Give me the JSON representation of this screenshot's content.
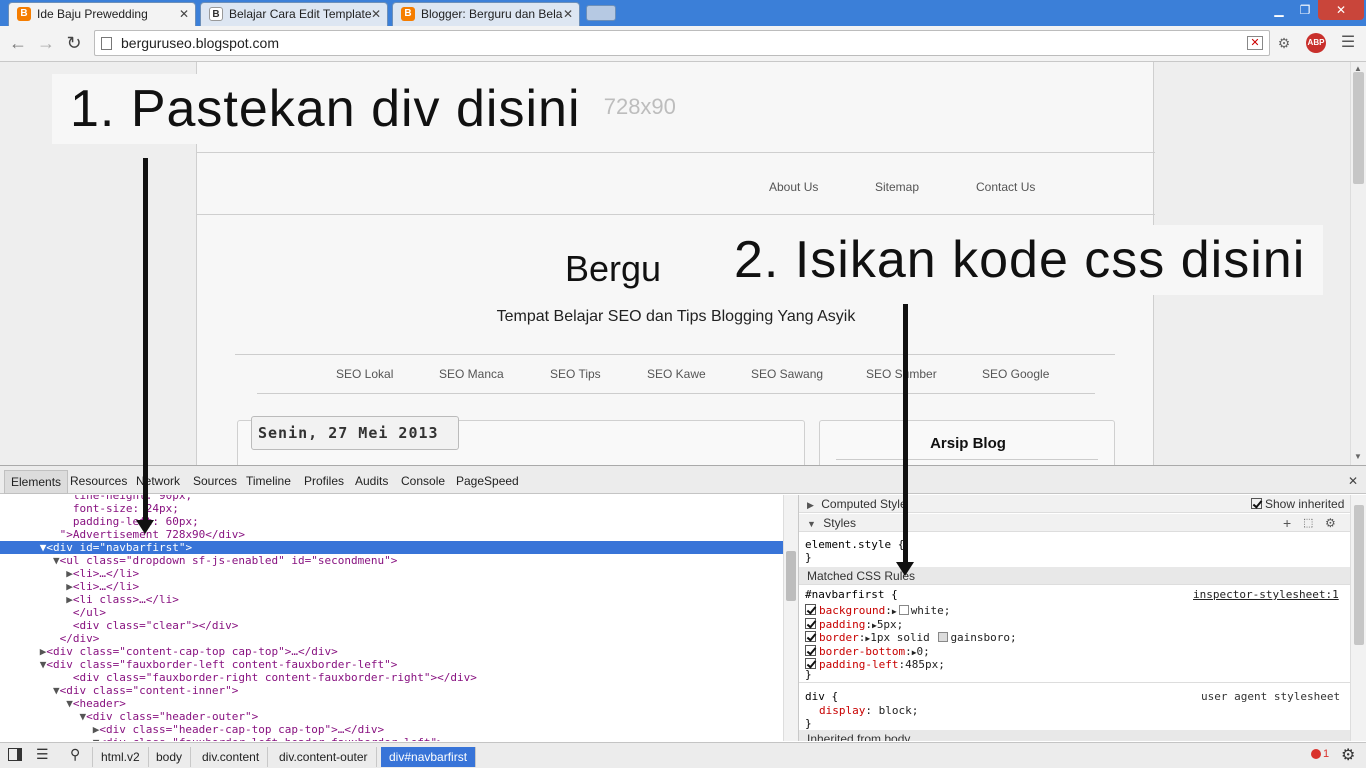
{
  "browser": {
    "tabs": [
      {
        "title": "Ide Baju Prewedding",
        "favicon": "B",
        "favicon_color": "#f57d00",
        "active": true
      },
      {
        "title": "Belajar Cara Edit Template",
        "favicon": "B",
        "favicon_color": "#ffffff"
      },
      {
        "title": "Blogger: Berguru dan Bela",
        "favicon": "B",
        "favicon_color": "#f57d00"
      }
    ],
    "url": "berguruseo.blogspot.com",
    "abp_label": "ABP"
  },
  "page": {
    "ad_text": "Advertisement 728x90",
    "top_menu": [
      "About Us",
      "Sitemap",
      "Contact Us"
    ],
    "blog_title": "Bergu",
    "blog_description": "Tempat Belajar SEO dan Tips Blogging Yang Asyik",
    "category_menu": [
      "SEO Lokal",
      "SEO Manca",
      "SEO Tips",
      "SEO Kawe",
      "SEO Sawang",
      "SEO Sumber",
      "SEO Google"
    ],
    "post_date": "Senin, 27 Mei 2013",
    "sidebar_title": "Arsip Blog"
  },
  "annotations": {
    "callout_1": "1. Pastekan div disini",
    "callout_2": "2. Isikan kode css disini"
  },
  "devtools": {
    "tabs": [
      "Elements",
      "Resources",
      "Network",
      "Sources",
      "Timeline",
      "Profiles",
      "Audits",
      "Console",
      "PageSpeed"
    ],
    "elements_lines": [
      {
        "indent": 10,
        "text": "line-height: 90px;",
        "tri": ""
      },
      {
        "indent": 10,
        "text": "font-size: 24px;",
        "tri": ""
      },
      {
        "indent": 10,
        "text": "padding-left: 60px;",
        "tri": ""
      },
      {
        "indent": 8,
        "text": "\">Advertisement 728x90</div>",
        "tri": ""
      },
      {
        "indent": 6,
        "text": "<div id=\"navbarfirst\">",
        "tri": "▼",
        "selected": true
      },
      {
        "indent": 8,
        "text": "<ul class=\"dropdown sf-js-enabled\" id=\"secondmenu\">",
        "tri": "▼"
      },
      {
        "indent": 10,
        "text": "<li>…</li>",
        "tri": "▶"
      },
      {
        "indent": 10,
        "text": "<li>…</li>",
        "tri": "▶"
      },
      {
        "indent": 10,
        "text": "<li class>…</li>",
        "tri": "▶"
      },
      {
        "indent": 10,
        "text": "</ul>",
        "tri": ""
      },
      {
        "indent": 10,
        "text": "<div class=\"clear\"></div>",
        "tri": ""
      },
      {
        "indent": 8,
        "text": "</div>",
        "tri": ""
      },
      {
        "indent": 6,
        "text": "<div class=\"content-cap-top cap-top\">…</div>",
        "tri": "▶"
      },
      {
        "indent": 6,
        "text": "<div class=\"fauxborder-left content-fauxborder-left\">",
        "tri": "▼"
      },
      {
        "indent": 10,
        "text": "<div class=\"fauxborder-right content-fauxborder-right\"></div>",
        "tri": ""
      },
      {
        "indent": 8,
        "text": "<div class=\"content-inner\">",
        "tri": "▼"
      },
      {
        "indent": 10,
        "text": "<header>",
        "tri": "▼"
      },
      {
        "indent": 12,
        "text": "<div class=\"header-outer\">",
        "tri": "▼"
      },
      {
        "indent": 14,
        "text": "<div class=\"header-cap-top cap-top\">…</div>",
        "tri": "▶"
      },
      {
        "indent": 14,
        "text": "<div class=\"fauxborder-left header-fauxborder-left\">",
        "tri": "▼"
      }
    ],
    "styles": {
      "computed_style_label": "Computed Style",
      "show_inherited_label": "Show inherited",
      "styles_label": "Styles",
      "element_style": "element.style {",
      "element_style_close": "}",
      "matched_label": "Matched CSS Rules",
      "rule_selector": "#navbarfirst {",
      "rule_source": "inspector-stylesheet:1",
      "declarations": [
        {
          "name": "background",
          "value": "white;",
          "swatch": "#ffffff",
          "expand": true
        },
        {
          "name": "padding",
          "value": "5px;",
          "expand": true
        },
        {
          "name": "border",
          "value": "1px solid ",
          "value2": "gainsboro;",
          "swatch": "#dcdcdc",
          "expand": true
        },
        {
          "name": "border-bottom",
          "value": "0;",
          "expand": true
        },
        {
          "name": "padding-left",
          "value": "485px;",
          "expand": false
        }
      ],
      "rule_close": "}",
      "ua_selector": "div {",
      "ua_source": "user agent stylesheet",
      "ua_decl_name": "display",
      "ua_decl_value": "block;",
      "ua_close": "}",
      "inherited_label": "Inherited from body"
    },
    "breadcrumbs": [
      "html.v2",
      "body",
      "div.content",
      "div.content-outer",
      "div#navbarfirst"
    ],
    "error_count": "1"
  }
}
